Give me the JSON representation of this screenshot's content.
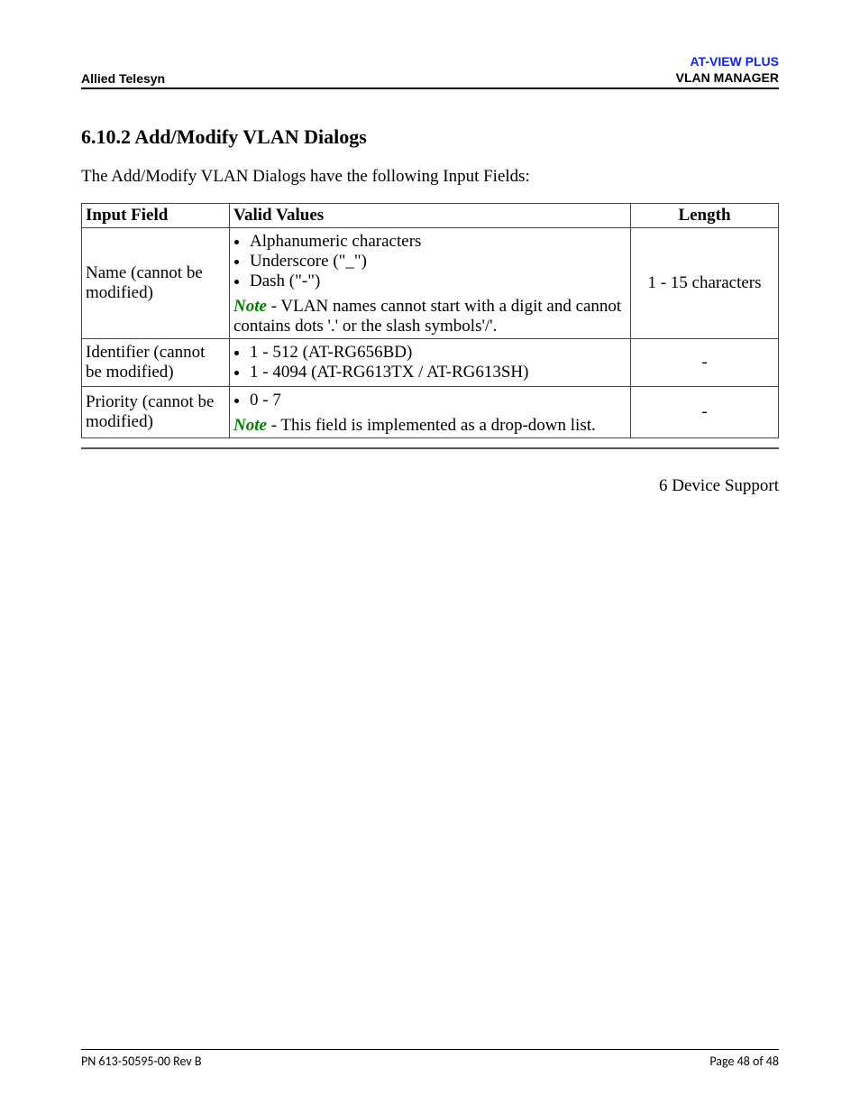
{
  "header": {
    "left": "Allied Telesyn",
    "right_line1": "AT-VIEW PLUS",
    "right_line2": "VLAN MANAGER"
  },
  "section_title": "6.10.2 Add/Modify VLAN Dialogs",
  "intro": "The Add/Modify VLAN Dialogs have the following Input Fields:",
  "table": {
    "head": {
      "field": "Input Field",
      "values": "Valid Values",
      "length": "Length"
    },
    "rows": {
      "name": {
        "field": "Name (cannot be modified)",
        "bullets": {
          "b0": "Alphanumeric characters",
          "b1": "Underscore (\"_\")",
          "b2": "Dash (\"-\")"
        },
        "note_label": "Note",
        "note_text": " - VLAN names cannot start with a digit and cannot contains dots '.' or the slash symbols'/'.",
        "length": "1 - 15 characters"
      },
      "identifier": {
        "field": "Identifier (cannot be modified)",
        "bullets": {
          "b0": "1 - 512 (AT-RG656BD)",
          "b1": "1 - 4094 (AT-RG613TX / AT-RG613SH)"
        },
        "length": "-"
      },
      "priority": {
        "field": "Priority (cannot be modified)",
        "bullets": {
          "b0": "0 - 7"
        },
        "note_label": "Note",
        "note_text": " - This field is implemented as a drop-down list.",
        "length": "-"
      }
    }
  },
  "rightlink": "6 Device Support",
  "footer": {
    "left": "PN 613-50595-00 Rev B",
    "right": "Page 48 of 48"
  }
}
